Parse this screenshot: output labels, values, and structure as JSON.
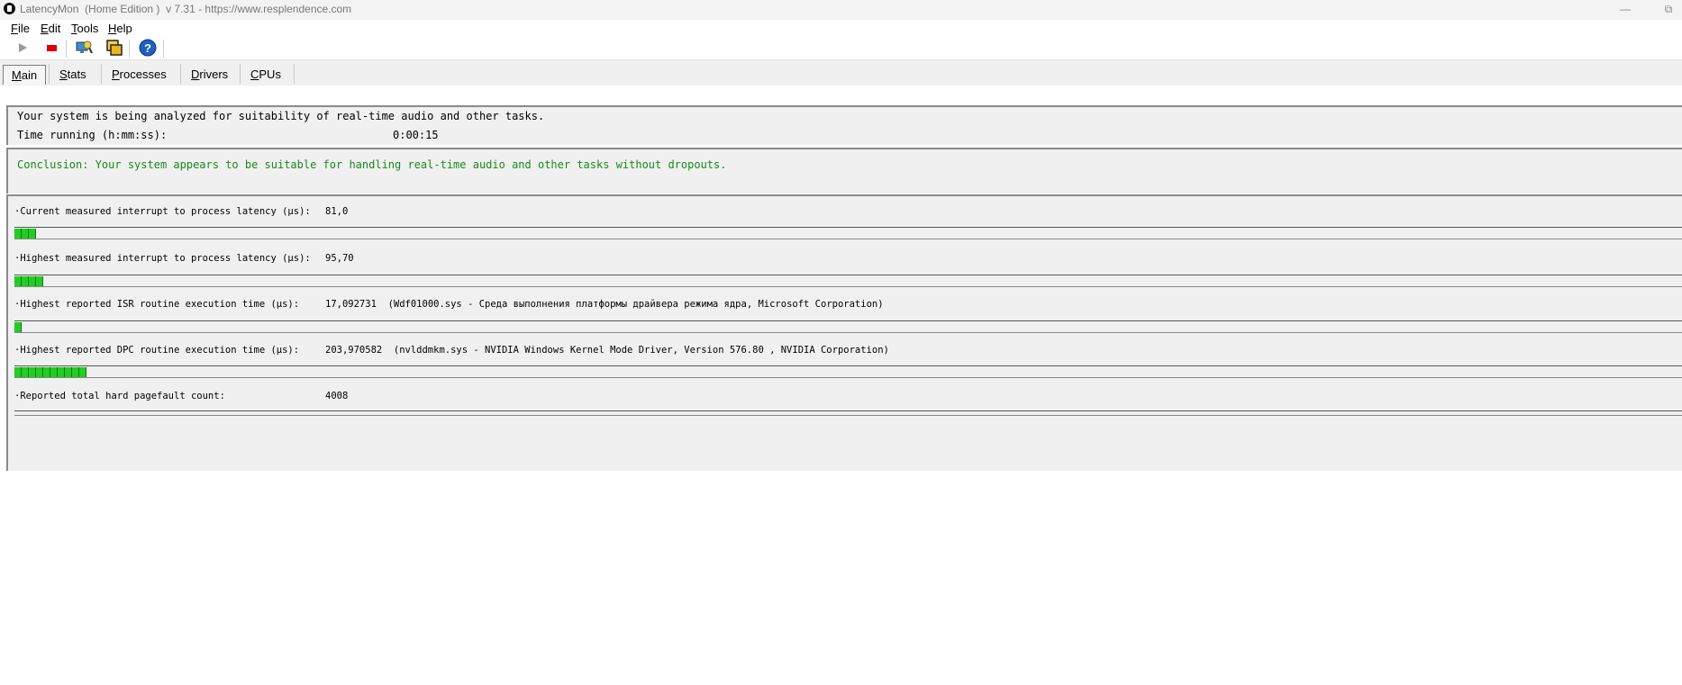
{
  "window": {
    "app_name": "LatencyMon",
    "title_rest": "  (Home Edition )  v 7.31 - https://www.resplendence.com",
    "minimize_glyph": "—",
    "restore_glyph": "⧉"
  },
  "menu": {
    "items": [
      "File",
      "Edit",
      "Tools",
      "Help"
    ]
  },
  "toolbar": {
    "icons": [
      "play-icon",
      "stop-icon",
      "monitor-icon",
      "windows-icon",
      "help-icon"
    ],
    "colors": {
      "stop": "#e00000",
      "help": "#1f5fbf"
    }
  },
  "tabs": {
    "items": [
      "Main",
      "Stats",
      "Processes",
      "Drivers",
      "CPUs"
    ],
    "active": "Main"
  },
  "status": {
    "line1": "Your system is being analyzed for suitability of real-time audio and other tasks.",
    "time_label": "Time running (h:mm:ss):",
    "time_value": "0:00:15"
  },
  "conclusion": {
    "text": "Conclusion: Your system appears to be suitable for handling real-time audio and other tasks without dropouts.",
    "color": "#1a8a1a"
  },
  "metrics": [
    {
      "label": "·Current measured interrupt to process latency (µs):",
      "value": "81,0",
      "detail": "",
      "bar_segments": 3
    },
    {
      "label": "·Highest measured interrupt to process latency (µs):",
      "value": "95,70",
      "detail": "",
      "bar_segments": 4
    },
    {
      "label": "·Highest reported ISR routine execution time (µs):",
      "value": "17,092731",
      "detail": "(Wdf01000.sys - Среда выполнения платформы драйвера режима ядра, Microsoft Corporation)",
      "bar_segments": 1
    },
    {
      "label": "·Highest reported DPC routine execution time (µs):",
      "value": "203,970582",
      "detail": "(nvlddmkm.sys - NVIDIA Windows Kernel Mode Driver, Version 576.80 , NVIDIA Corporation)",
      "bar_segments": 10
    },
    {
      "label": "·Reported total hard pagefault count:",
      "value": "4008",
      "detail": "",
      "bar_segments": 0
    }
  ],
  "bar_color": "#22cc22"
}
